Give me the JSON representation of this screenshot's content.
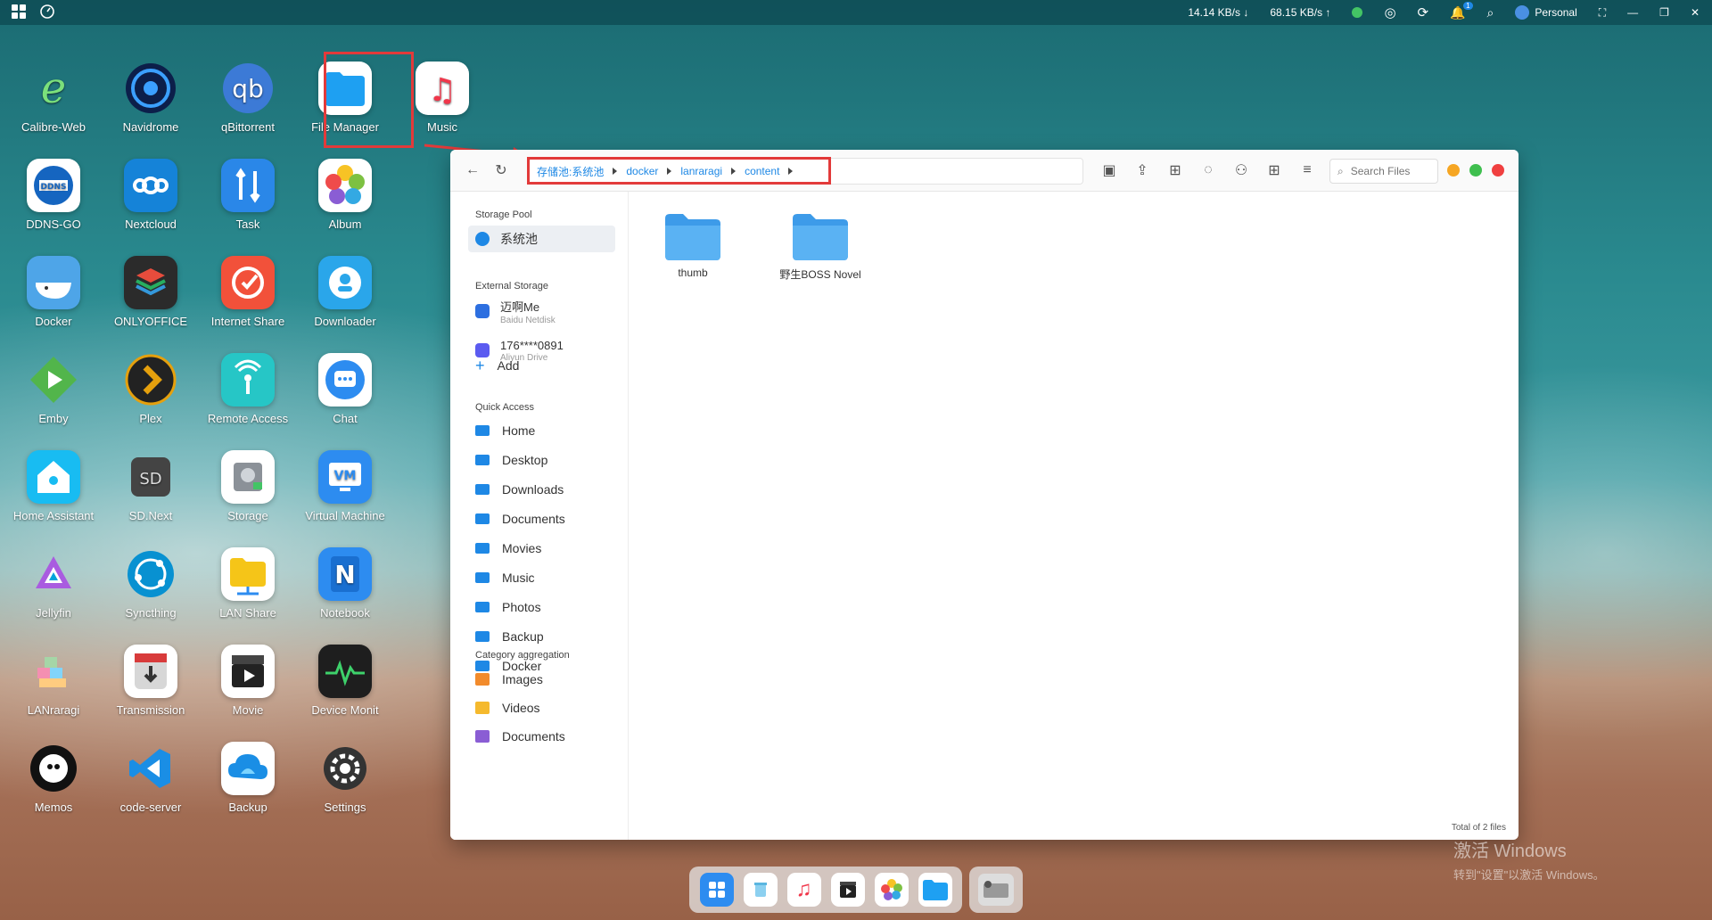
{
  "topbar": {
    "download_speed": "14.14 KB/s",
    "upload_speed": "68.15 KB/s",
    "user": "Personal",
    "notification_badge": "1"
  },
  "desktop_apps": [
    {
      "label": "Calibre-Web",
      "icon": "calibre-icon"
    },
    {
      "label": "Navidrome",
      "icon": "navidrome-icon"
    },
    {
      "label": "qBittorrent",
      "icon": "qbittorrent-icon"
    },
    {
      "label": "File Manager",
      "icon": "folder-icon"
    },
    {
      "label": "Music",
      "icon": "music-icon"
    },
    {
      "label": "DDNS-GO",
      "icon": "ddns-icon"
    },
    {
      "label": "Nextcloud",
      "icon": "nextcloud-icon"
    },
    {
      "label": "Task",
      "icon": "task-icon"
    },
    {
      "label": "Album",
      "icon": "album-icon"
    },
    {
      "label": "Docker",
      "icon": "docker-icon"
    },
    {
      "label": "ONLYOFFICE",
      "icon": "onlyoffice-icon"
    },
    {
      "label": "Internet Share",
      "icon": "internet-share-icon"
    },
    {
      "label": "Downloader",
      "icon": "downloader-icon"
    },
    {
      "label": "Emby",
      "icon": "emby-icon"
    },
    {
      "label": "Plex",
      "icon": "plex-icon"
    },
    {
      "label": "Remote Access",
      "icon": "remote-access-icon"
    },
    {
      "label": "Chat",
      "icon": "chat-icon"
    },
    {
      "label": "Home Assistant",
      "icon": "home-assistant-icon"
    },
    {
      "label": "SD.Next",
      "icon": "sdnext-icon"
    },
    {
      "label": "Storage",
      "icon": "storage-icon"
    },
    {
      "label": "Virtual Machine",
      "icon": "vm-icon"
    },
    {
      "label": "Jellyfin",
      "icon": "jellyfin-icon"
    },
    {
      "label": "Syncthing",
      "icon": "syncthing-icon"
    },
    {
      "label": "LAN Share",
      "icon": "lan-share-icon"
    },
    {
      "label": "Notebook",
      "icon": "notebook-icon"
    },
    {
      "label": "LANraragi",
      "icon": "lanraragi-icon"
    },
    {
      "label": "Transmission",
      "icon": "transmission-icon"
    },
    {
      "label": "Movie",
      "icon": "movie-icon"
    },
    {
      "label": "Device Monit",
      "icon": "device-monitor-icon"
    },
    {
      "label": "Memos",
      "icon": "memos-icon"
    },
    {
      "label": "code-server",
      "icon": "code-server-icon"
    },
    {
      "label": "Backup",
      "icon": "backup-icon"
    },
    {
      "label": "Settings",
      "icon": "settings-icon"
    }
  ],
  "file_manager": {
    "breadcrumbs": [
      "存储池:系统池",
      "docker",
      "lanraragi",
      "content"
    ],
    "search_placeholder": "Search Files",
    "sidebar": {
      "storage_pool_title": "Storage Pool",
      "storage_pool_item": "系统池",
      "external_title": "External Storage",
      "external": [
        {
          "name": "迈啊Me",
          "sub": "Baidu Netdisk"
        },
        {
          "name": "176****0891",
          "sub": "Aliyun Drive"
        }
      ],
      "add_label": "Add",
      "quick_title": "Quick Access",
      "quick": [
        "Home",
        "Desktop",
        "Downloads",
        "Documents",
        "Movies",
        "Music",
        "Photos",
        "Backup",
        "Docker"
      ],
      "category_title": "Category aggregation",
      "categories": [
        "Images",
        "Videos",
        "Documents"
      ]
    },
    "files": [
      "thumb",
      "野生BOSS Novel"
    ],
    "footer": "Total of 2 files"
  },
  "watermark": {
    "line1": "激活 Windows",
    "line2": "转到\"设置\"以激活 Windows。"
  },
  "colors": {
    "accent": "#1e88e5",
    "highlight": "#e23a3a",
    "folder": "#4aa3e8"
  }
}
